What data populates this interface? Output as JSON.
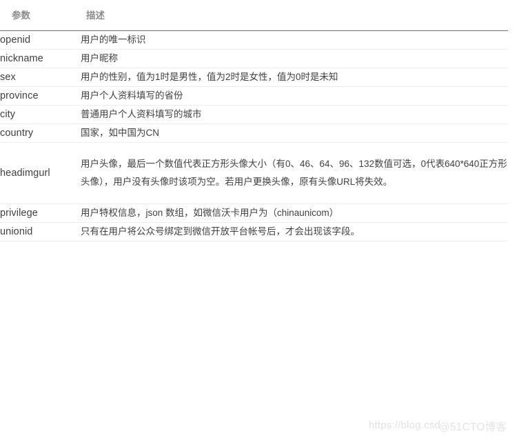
{
  "table": {
    "headers": {
      "param": "参数",
      "desc": "描述"
    },
    "rows": [
      {
        "param": "openid",
        "desc": "用户的唯一标识"
      },
      {
        "param": "nickname",
        "desc": "用户昵称"
      },
      {
        "param": "sex",
        "desc": "用户的性别，值为1时是男性，值为2时是女性，值为0时是未知"
      },
      {
        "param": "province",
        "desc": "用户个人资料填写的省份"
      },
      {
        "param": "city",
        "desc": "普通用户个人资料填写的城市"
      },
      {
        "param": "country",
        "desc": "国家，如中国为CN"
      },
      {
        "param": "headimgurl",
        "desc": "用户头像，最后一个数值代表正方形头像大小（有0、46、64、96、132数值可选，0代表640*640正方形头像），用户没有头像时该项为空。若用户更换头像，原有头像URL将失效。"
      },
      {
        "param": "privilege",
        "desc": "用户特权信息，json 数组，如微信沃卡用户为（chinaunicom）"
      },
      {
        "param": "unionid",
        "desc": "只有在用户将公众号绑定到微信开放平台帐号后，才会出现该字段。"
      }
    ]
  },
  "watermarks": {
    "url": "https://blog.csd",
    "brand": "@51CTO博客"
  },
  "colors": {
    "header_text": "#8d8d8d",
    "header_border": "#6f6f6f",
    "row_border": "#ececec",
    "body_text": "#404040",
    "param_text": "#3f3f3f",
    "watermark": "#e2e2e2",
    "background": "#ffffff"
  }
}
